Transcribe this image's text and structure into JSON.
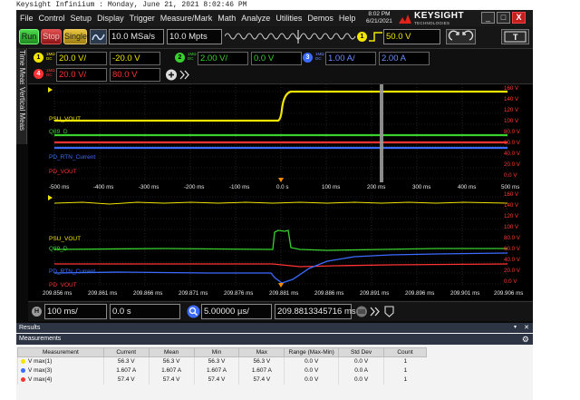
{
  "caption": "Keysight Infiniium : Monday, June 21, 2021 8:02:46 PM",
  "menu": [
    "File",
    "Control",
    "Setup",
    "Display",
    "Trigger",
    "Measure/Mark",
    "Math",
    "Analyze",
    "Utilities",
    "Demos",
    "Help"
  ],
  "clock": {
    "time": "8:02 PM",
    "date": "6/21/2021"
  },
  "brand": {
    "name": "KEYSIGHT",
    "sub": "TECHNOLOGIES"
  },
  "window": {
    "minimize": "_",
    "restore": "□",
    "close": "X"
  },
  "control": {
    "run": "Run",
    "stop": "Stop",
    "single": "Single",
    "sample_rate": "10.0 MSa/s",
    "memory_depth": "10.0 Mpts",
    "trigger_channel": "1",
    "trigger_level": "50.0 V",
    "touch_label": "T"
  },
  "side_tabs": {
    "time_meas": "Time Meas",
    "vertical_meas": "Vertical Meas"
  },
  "channels": [
    {
      "num": "1",
      "coupling": "1MΩ DC",
      "scale": "20.0 V/",
      "offset": "-20.0 V",
      "color": "#f2e600"
    },
    {
      "num": "2",
      "coupling": "1MΩ DC",
      "scale": "2.00 V/",
      "offset": "0.0 V",
      "color": "#39d12e"
    },
    {
      "num": "3",
      "coupling": "1MΩ DC",
      "scale": "1.00 A/",
      "offset": "2.00 A",
      "color": "#3b6bff"
    },
    {
      "num": "4",
      "coupling": "1MΩ DC",
      "scale": "20.0 V/",
      "offset": "80.0 V",
      "color": "#ff3333"
    }
  ],
  "plot1": {
    "signals": [
      "PSU_VOUT",
      "Q89_D",
      "PD_RTN_Current",
      "PD_VOUT"
    ],
    "scale": [
      "160 V",
      "140 V",
      "120 V",
      "100 V",
      "80.0 V",
      "60.0 V",
      "40.0 V",
      "20.0 V",
      "0.0 V"
    ],
    "time_axis": [
      "-500 ms",
      "-400 ms",
      "-300 ms",
      "-200 ms",
      "-100 ms",
      "0.0 s",
      "100 ms",
      "200 ms",
      "300 ms",
      "400 ms",
      "500 ms"
    ]
  },
  "plot2": {
    "signals": [
      "PSU_VOUT",
      "Q89_D",
      "PD_RTN_Current",
      "PD_VOUT"
    ],
    "scale": [
      "160 V",
      "140 V",
      "120 V",
      "100 V",
      "80.0 V",
      "60.0 V",
      "40.0 V",
      "20.0 V",
      "0.0 V"
    ],
    "time_axis": [
      "209.856 ms",
      "209.861 ms",
      "209.866 ms",
      "209.871 ms",
      "209.876 ms",
      "209.881 ms",
      "209.886 ms",
      "209.891 ms",
      "209.896 ms",
      "209.901 ms",
      "209.906 ms"
    ]
  },
  "horizontal": {
    "label": "H",
    "timebase": "100 ms/",
    "position": "0.0 s",
    "zoom_scale": "5.00000 µs/",
    "zoom_position": "209.8813345716 ms"
  },
  "results": {
    "title": "Results",
    "tab": "Measurements",
    "columns": [
      "Measurement",
      "Current",
      "Mean",
      "Min",
      "Max",
      "Range (Max-Min)",
      "Std Dev",
      "Count"
    ],
    "rows": [
      {
        "name": "V max(1)",
        "current": "56.3 V",
        "mean": "56.3 V",
        "min": "56.3 V",
        "max": "56.3 V",
        "range": "0.0 V",
        "std": "0.0 V",
        "count": "1",
        "color": "#f2e600"
      },
      {
        "name": "V max(3)",
        "current": "1.607 A",
        "mean": "1.607 A",
        "min": "1.607 A",
        "max": "1.607 A",
        "range": "0.0 V",
        "std": "0.0 A",
        "count": "1",
        "color": "#3b6bff"
      },
      {
        "name": "V max(4)",
        "current": "57.4 V",
        "mean": "57.4 V",
        "min": "57.4 V",
        "max": "57.4 V",
        "range": "0.0 V",
        "std": "0.0 V",
        "count": "1",
        "color": "#ff3333"
      }
    ]
  }
}
